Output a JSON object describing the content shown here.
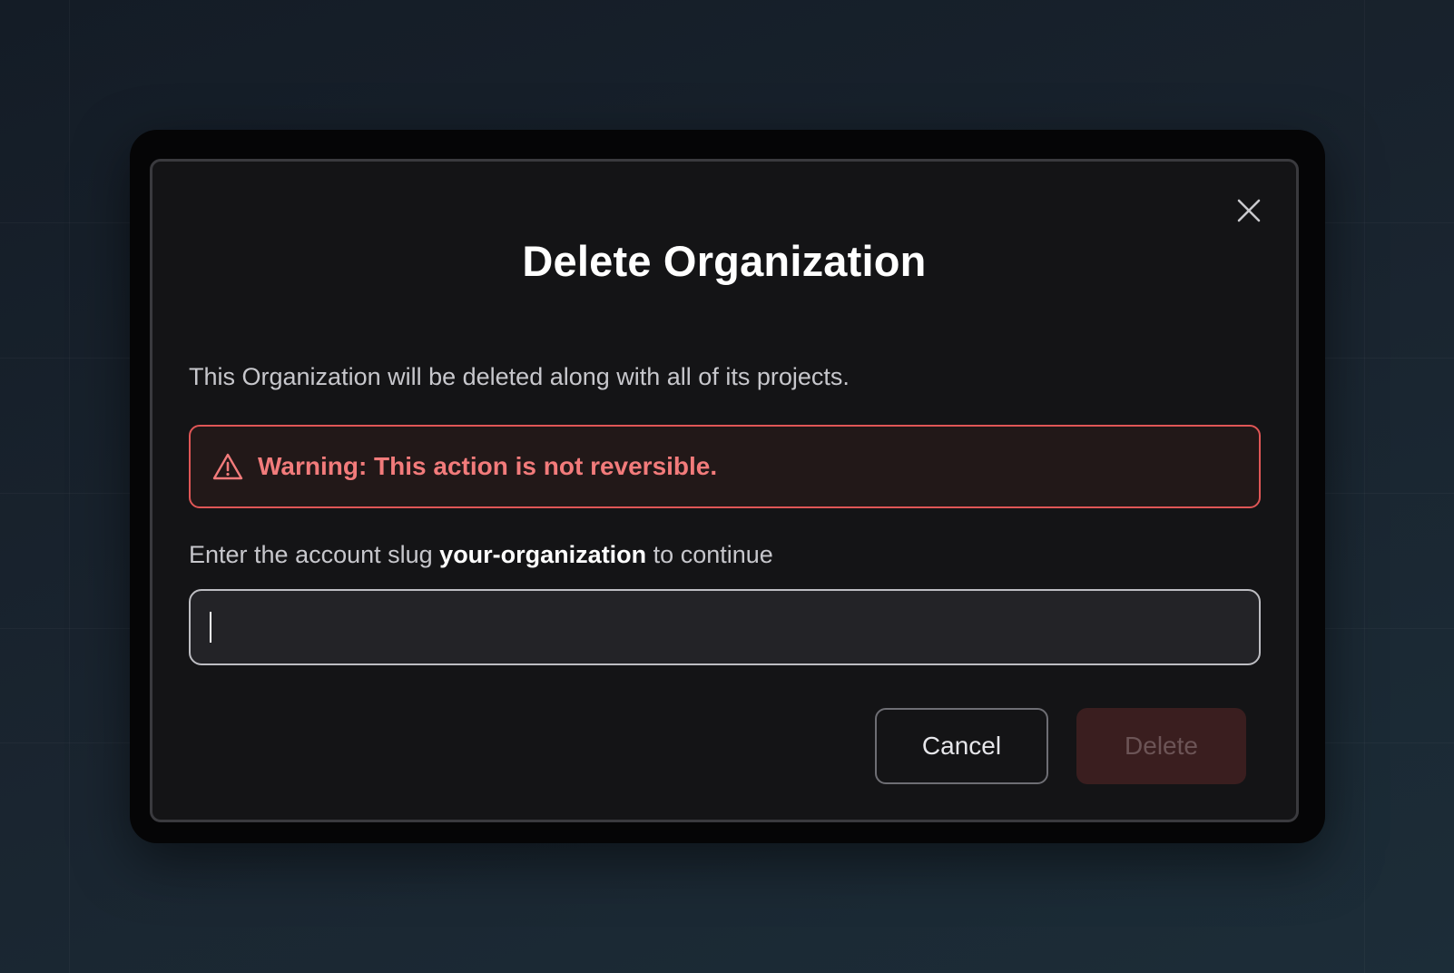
{
  "dialog": {
    "title": "Delete Organization",
    "description": "This Organization will be deleted along with all of its projects.",
    "warning": {
      "icon": "warning-triangle-icon",
      "text": "Warning: This action is not reversible."
    },
    "prompt": {
      "before": "Enter the account slug ",
      "slug": "your-organization",
      "after": " to continue"
    },
    "input": {
      "value": "",
      "placeholder": ""
    },
    "buttons": {
      "cancel_label": "Cancel",
      "delete_label": "Delete"
    },
    "close_icon": "close-icon"
  },
  "colors": {
    "warning_text": "#f27b7b",
    "warning_border": "#e05656",
    "warning_bg": "#221818",
    "delete_disabled_bg": "#3a1e1f",
    "modal_bg": "#141416"
  },
  "state": {
    "delete_enabled": false,
    "input_focused": true
  }
}
